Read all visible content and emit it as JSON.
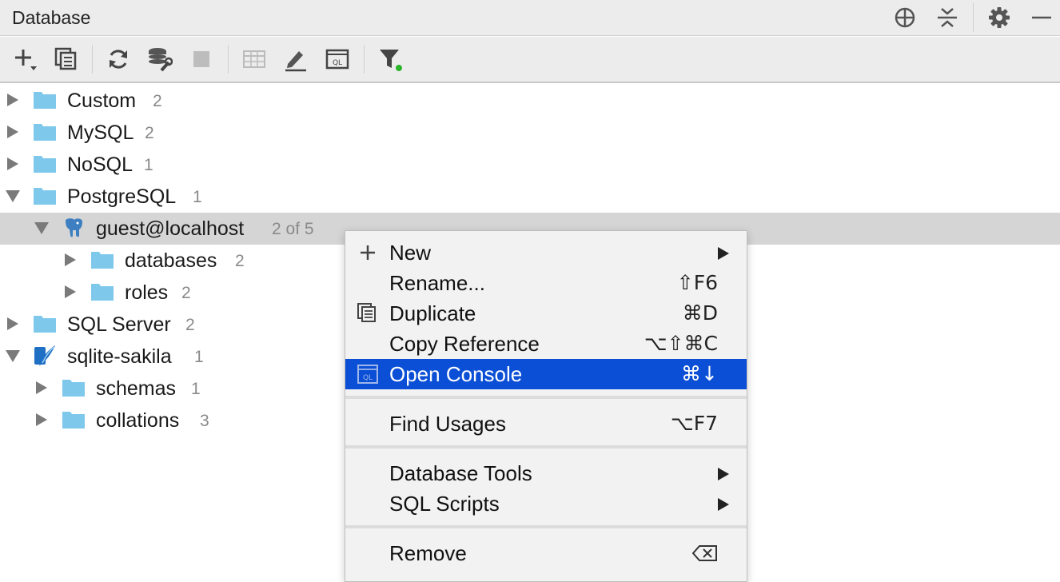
{
  "panel": {
    "title": "Database"
  },
  "title_icons": [
    "crosshair-icon",
    "collapse-all-icon",
    "gear-icon",
    "minimize-icon"
  ],
  "toolbar": {
    "icons": [
      "add-icon",
      "duplicate-icon",
      "refresh-icon",
      "properties-icon",
      "stop-icon",
      "table-icon",
      "edit-icon",
      "console-icon",
      "filter-icon"
    ]
  },
  "tree": [
    {
      "label": "Custom",
      "count": "2",
      "state": "collapsed",
      "icon": "folder-icon"
    },
    {
      "label": "MySQL",
      "count": "2",
      "state": "collapsed",
      "icon": "folder-icon"
    },
    {
      "label": "NoSQL",
      "count": "1",
      "state": "collapsed",
      "icon": "folder-icon"
    },
    {
      "label": "PostgreSQL",
      "count": "1",
      "state": "expanded",
      "icon": "folder-icon"
    },
    {
      "label": "guest@localhost",
      "count": "2 of 5",
      "state": "expanded",
      "icon": "postgresql-elephant-icon",
      "selected": true
    },
    {
      "label": "databases",
      "count": "2",
      "state": "collapsed",
      "icon": "folder-icon"
    },
    {
      "label": "roles",
      "count": "2",
      "state": "collapsed",
      "icon": "folder-icon"
    },
    {
      "label": "SQL Server",
      "count": "2",
      "state": "collapsed",
      "icon": "folder-icon"
    },
    {
      "label": "sqlite-sakila",
      "count": "1",
      "state": "expanded",
      "icon": "sqlite-feather-icon"
    },
    {
      "label": "schemas",
      "count": "1",
      "state": "collapsed",
      "icon": "folder-icon"
    },
    {
      "label": "collations",
      "count": "3",
      "state": "collapsed",
      "icon": "folder-icon"
    }
  ],
  "context_menu": {
    "items": [
      {
        "label": "New",
        "shortcut": "",
        "submenu": true,
        "icon": "plus-icon"
      },
      {
        "label": "Rename...",
        "shortcut": "⇧F6"
      },
      {
        "label": "Duplicate",
        "shortcut": "⌘D",
        "icon": "duplicate-icon"
      },
      {
        "label": "Copy Reference",
        "shortcut": "⌥⇧⌘C"
      },
      {
        "label": "Open Console",
        "shortcut": "⌘↓",
        "icon": "console-icon",
        "highlighted": true
      },
      {
        "label": "Find Usages",
        "shortcut": "⌥F7"
      },
      {
        "label": "Database Tools",
        "shortcut": "",
        "submenu": true
      },
      {
        "label": "SQL Scripts",
        "shortcut": "",
        "submenu": true
      },
      {
        "label": "Remove",
        "shortcut": "",
        "shortcut_icon": "delete-key-icon"
      }
    ]
  },
  "colors": {
    "folder": "#7ec8ec",
    "highlight": "#0b4fd6",
    "filter_dot": "#2bb52b",
    "count_text": "#8a8a8a"
  }
}
